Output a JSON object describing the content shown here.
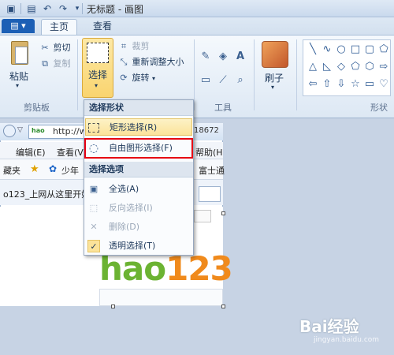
{
  "window": {
    "title": "无标题 - 画图"
  },
  "quick_access": {
    "icons": [
      "paint-app-icon",
      "save-icon",
      "undo-icon",
      "redo-icon",
      "customize-icon"
    ]
  },
  "tabs": [
    {
      "label": "主页",
      "active": true
    },
    {
      "label": "查看",
      "active": false
    }
  ],
  "ribbon": {
    "clipboard": {
      "paste_label": "粘贴",
      "cut_label": "剪切",
      "copy_label": "复制",
      "group_label": "剪贴板"
    },
    "image": {
      "select_label": "选择",
      "crop_label": "裁剪",
      "resize_label": "重新调整大小",
      "rotate_label": "旋转"
    },
    "tools": {
      "group_label": "工具"
    },
    "brushes": {
      "label": "刷子"
    },
    "shapes": {
      "group_label": "形状"
    }
  },
  "dropdown": {
    "header_shape": "选择形状",
    "items_shape": [
      {
        "label": "矩形选择(R)",
        "icon": "rect-select-icon",
        "highlighted": true,
        "disabled": false
      },
      {
        "label": "自由图形选择(F)",
        "icon": "free-select-icon",
        "highlighted": false,
        "disabled": false
      }
    ],
    "header_options": "选择选项",
    "items_options": [
      {
        "label": "全选(A)",
        "icon": "select-all-icon",
        "disabled": false
      },
      {
        "label": "反向选择(I)",
        "icon": "invert-select-icon",
        "disabled": true
      },
      {
        "label": "删除(D)",
        "icon": "delete-icon",
        "disabled": true
      },
      {
        "label": "透明选择(T)",
        "icon": "checkmark-icon",
        "disabled": false
      }
    ]
  },
  "embedded_browser": {
    "url": "http://w",
    "url_suffix": "18672",
    "menu_items": [
      "编辑(E)",
      "查看(V",
      "帮助(H"
    ],
    "fav_items": [
      "藏夹",
      "少年",
      "富士通"
    ],
    "tab_text": "o123_上网从这里开始",
    "logo_text": "hao123"
  },
  "watermark": {
    "main": "Bai经验",
    "sub": "jingyan.baidu.com"
  },
  "colors": {
    "highlight_border": "#e60012",
    "logo_green": "#6bb332",
    "logo_orange": "#f08a1c"
  }
}
